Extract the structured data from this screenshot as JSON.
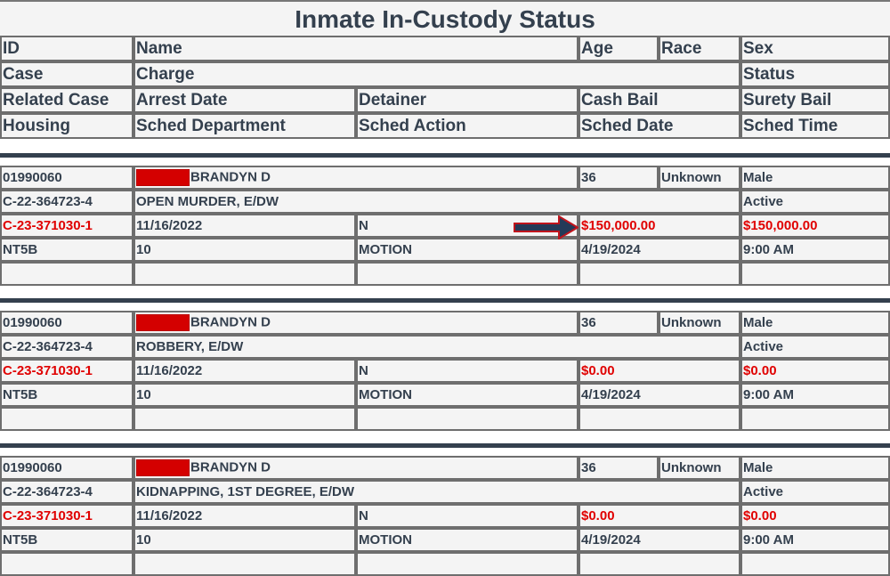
{
  "page": {
    "title": "Inmate In-Custody Status"
  },
  "header": {
    "row1": [
      "ID",
      "Name",
      "Age",
      "Race",
      "Sex"
    ],
    "row2": [
      "Case",
      "Charge",
      "Status"
    ],
    "row3": [
      "Related Case",
      "Arrest Date",
      "Detainer",
      "Cash Bail",
      "Surety Bail"
    ],
    "row4": [
      "Housing",
      "Sched Department",
      "Sched Action",
      "Sched Date",
      "Sched Time"
    ]
  },
  "records": [
    {
      "id": "01990060",
      "name": "BRANDYN D",
      "name_redacted": true,
      "age": "36",
      "race": "Unknown",
      "sex": "Male",
      "case": "C-22-364723-4",
      "charge": "OPEN MURDER, E/DW",
      "status": "Active",
      "related_case": "C-23-371030-1",
      "arrest_date": "11/16/2022",
      "detainer": "N",
      "cash_bail": "$150,000.00",
      "surety_bail": "$150,000.00",
      "housing": "NT5B",
      "sched_department": "10",
      "sched_action": "MOTION",
      "sched_date": "4/19/2024",
      "sched_time": "9:00 AM",
      "annotation": "arrow-pointing-to-cash-bail"
    },
    {
      "id": "01990060",
      "name": "BRANDYN D",
      "name_redacted": true,
      "age": "36",
      "race": "Unknown",
      "sex": "Male",
      "case": "C-22-364723-4",
      "charge": "ROBBERY, E/DW",
      "status": "Active",
      "related_case": "C-23-371030-1",
      "arrest_date": "11/16/2022",
      "detainer": "N",
      "cash_bail": "$0.00",
      "surety_bail": "$0.00",
      "housing": "NT5B",
      "sched_department": "10",
      "sched_action": "MOTION",
      "sched_date": "4/19/2024",
      "sched_time": "9:00 AM"
    },
    {
      "id": "01990060",
      "name": "BRANDYN D",
      "name_redacted": true,
      "age": "36",
      "race": "Unknown",
      "sex": "Male",
      "case": "C-22-364723-4",
      "charge": "KIDNAPPING, 1ST DEGREE, E/DW",
      "status": "Active",
      "related_case": "C-23-371030-1",
      "arrest_date": "11/16/2022",
      "detainer": "N",
      "cash_bail": "$0.00",
      "surety_bail": "$0.00",
      "housing": "NT5B",
      "sched_department": "10",
      "sched_action": "MOTION",
      "sched_date": "4/19/2024",
      "sched_time": "9:00 AM"
    }
  ],
  "colors": {
    "text": "#34404e",
    "highlight_red": "#e00000",
    "redaction": "#d40000",
    "separator": "#34404e",
    "cell_bg": "#f4f4f4",
    "border": "#6e6e6e",
    "arrow_fill": "#243a58",
    "arrow_outline": "#c0141c"
  }
}
